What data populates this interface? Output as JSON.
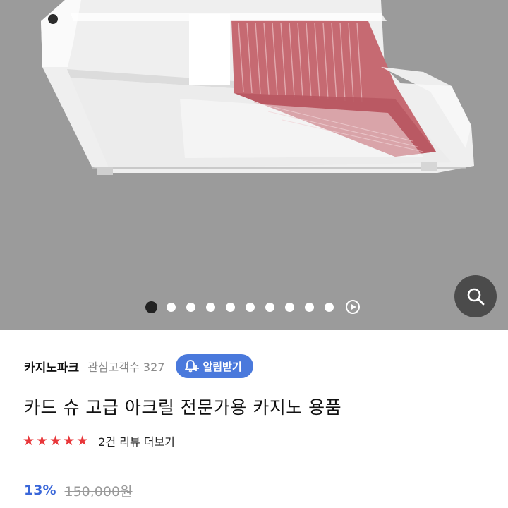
{
  "gallery": {
    "image_alt": "acrylic-card-shoe-product-photo",
    "slide_count": 10,
    "active_index": 0,
    "search_icon": "magnifier-icon",
    "play_icon": "play-icon"
  },
  "seller": {
    "name": "카지노파크",
    "followers": "관심고객수 327",
    "alert_button": "알림받기",
    "alert_icon": "bell-plus-icon"
  },
  "product": {
    "title": "카드 슈 고급 아크릴 전문가용 카지노 용품",
    "rating_stars": 5,
    "reviews_link": "2건 리뷰 더보기",
    "discount": "13%",
    "original_price": "150,000원"
  },
  "colors": {
    "hero_bg": "#9b9b9b",
    "accent_blue": "#4a79dc",
    "discount_blue": "#3a67d9",
    "star_red": "#e8373a"
  }
}
